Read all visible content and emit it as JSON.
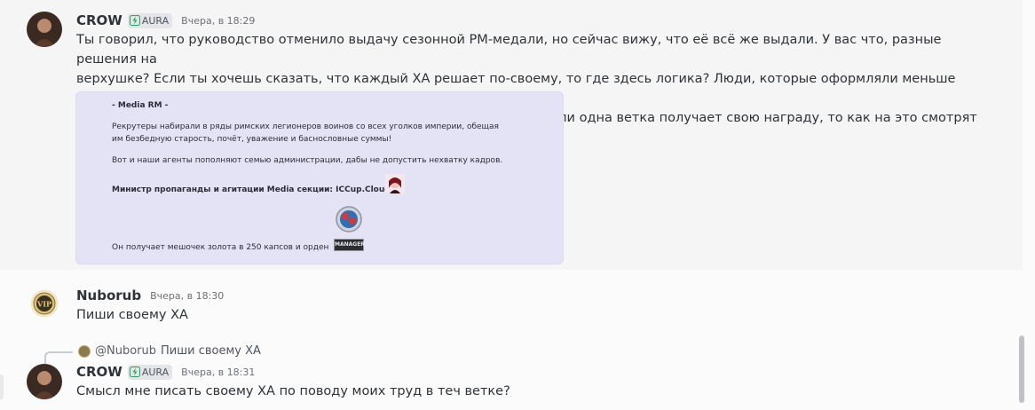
{
  "messages": [
    {
      "username": "CROW",
      "tag": "AURA",
      "time": "Вчера, в 18:29",
      "lines": [
        "Ты говорил, что руководство отменило выдачу сезонной РМ-медали, но сейчас вижу, что её всё же выдали. У вас что, разные решения на",
        "верхушке? Если ты хочешь сказать, что каждый ХА решает по-своему, то где здесь логика? Люди, которые оформляли меньше админов,",
        "получают сезонную медаль, а тот, кто делал это лучше них — нет? Если одна ветка получает свою награду, то как на это смотрят другие?"
      ],
      "attachment": {
        "title": "- Media RM -",
        "para1_line1": "Рекрутеры набирали в ряды римских легионеров воинов со всех уголков империи, обещая",
        "para1_line2": "им безбедную старость, почёт, уважение и баснословные суммы!",
        "para2": "Вот и наши агенты пополняют семью администрации, дабы не допустить нехватку кадров.",
        "minister": "Министр пропаганды и агитации Media секции: ICCup.Cloudy",
        "reward": "Он получает мешочек золота в 250 капсов и орден",
        "badge_label": "MANAGER"
      }
    },
    {
      "username": "Nuborub",
      "time": "Вчера, в 18:30",
      "avatar_text": "VIP",
      "text": "Пиши своему ХА"
    },
    {
      "reply_to": {
        "mention": "@Nuborub",
        "text": "Пиши своему ХА"
      },
      "username": "CROW",
      "tag": "AURA",
      "time": "Вчера, в 18:31",
      "text": "Смысл мне писать своему ХА по поводу моих труд в теч ветке?"
    }
  ],
  "colors": {
    "background": "#fbfbfb",
    "embed_bg": "#e3e3f5",
    "tag_icon": "#23a55a"
  },
  "icons": {
    "tag": "lightning-icon"
  }
}
